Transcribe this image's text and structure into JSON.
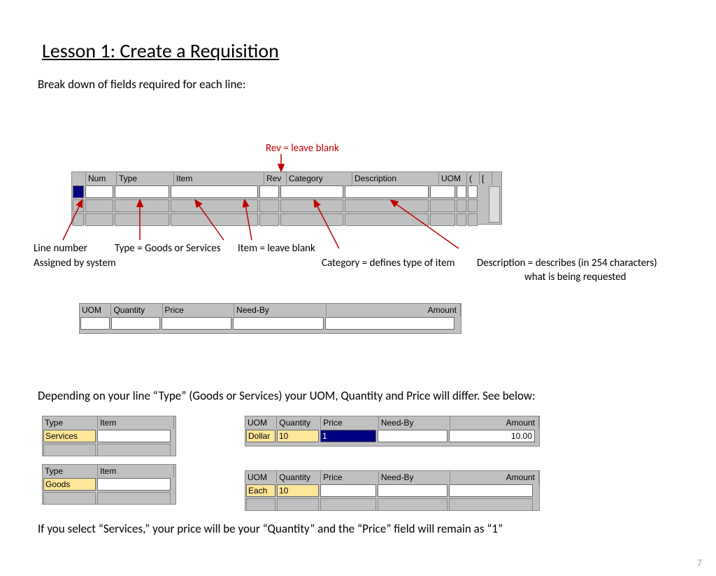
{
  "title": "Lesson 1:  Create a Requisition",
  "intro": "Break down of fields required for each line:",
  "callouts": {
    "rev": "Rev = leave blank",
    "linenum": "Line number",
    "assigned": "Assigned by system",
    "type": "Type = Goods or Services",
    "item": "Item = leave blank",
    "category": "Category = defines type of item",
    "desc1": "Description = describes (in 254 characters)",
    "desc2": "what is being requested"
  },
  "grid1": {
    "headers": [
      "Num",
      "Type",
      "Item",
      "Rev",
      "Category",
      "Description",
      "UOM"
    ]
  },
  "grid2": {
    "headers": [
      "UOM",
      "Quantity",
      "Price",
      "Need-By",
      "Amount"
    ]
  },
  "midtext": "Depending on your line “Type” (Goods or Services) your UOM, Quantity and Price will differ.  See below:",
  "type_services": {
    "headers": [
      "Type",
      "Item"
    ],
    "values": [
      "Services",
      ""
    ]
  },
  "type_goods": {
    "headers": [
      "Type",
      "Item"
    ],
    "values": [
      "Goods",
      ""
    ]
  },
  "services_row": {
    "headers": [
      "UOM",
      "Quantity",
      "Price",
      "Need-By",
      "Amount"
    ],
    "values": [
      "Dollar",
      "10",
      "1",
      "",
      "10.00"
    ]
  },
  "goods_row": {
    "headers": [
      "UOM",
      "Quantity",
      "Price",
      "Need-By",
      "Amount"
    ],
    "values": [
      "Each",
      "10",
      "",
      "",
      ""
    ]
  },
  "bottom_text": "If you select “Services,” your price will be your “Quantity” and the “Price” field will remain as “1”",
  "page_number": "7"
}
